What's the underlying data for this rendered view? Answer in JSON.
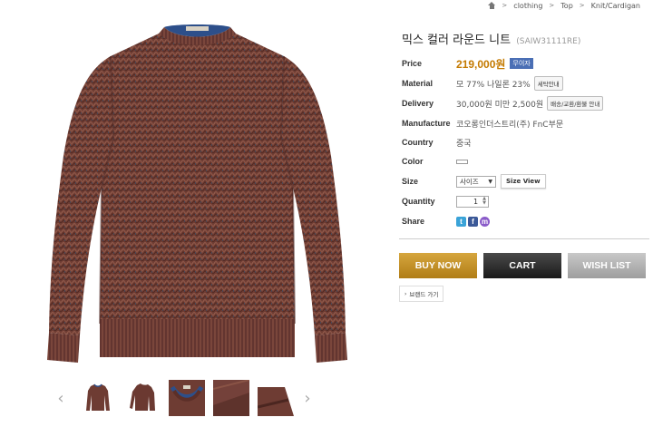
{
  "breadcrumb": {
    "items": [
      "clothing",
      "Top",
      "Knit/Cardigan"
    ],
    "separator": ">"
  },
  "product": {
    "name": "믹스 컬러 라운드 니트",
    "code": "(SAIW31111RE)"
  },
  "labels": {
    "price": "Price",
    "material": "Material",
    "delivery": "Delivery",
    "manufacture": "Manufacture",
    "country": "Country",
    "color": "Color",
    "size": "Size",
    "quantity": "Quantity",
    "share": "Share"
  },
  "values": {
    "price": "219,000원",
    "price_badge": "무이자",
    "material": "모 77% 나일론 23%",
    "material_btn": "세탁안내",
    "delivery": "30,000원 미만 2,500원",
    "delivery_btn": "배송/교환/환불 안내",
    "manufacture": "코오롱인더스트리(주) FnC부문",
    "country": "중국",
    "size_select": "사이즈",
    "size_view_btn": "Size View",
    "quantity": "1",
    "quantity_stepper_up": "▲",
    "quantity_stepper_down": "▼",
    "select_chevron": "▼",
    "share_icons": [
      "twitter-icon",
      "facebook-icon",
      "me2day-icon"
    ],
    "share_icon_glyphs": [
      "t",
      "f",
      "m"
    ]
  },
  "thumbnail_nav": {
    "prev": "‹",
    "next": "›"
  },
  "actions": {
    "buy_now": "BUY NOW",
    "cart": "CART",
    "wish_list": "WISH LIST"
  },
  "brand_link": {
    "caret": "›",
    "label": "브랜드 가기"
  },
  "colors": {
    "price": "#c47a00",
    "badge": "#4a6fb5",
    "buy_now": "#c6921f",
    "cart": "#2a2a2a",
    "wish_list": "#b3b3b3",
    "sweater": "#6b3a32"
  }
}
